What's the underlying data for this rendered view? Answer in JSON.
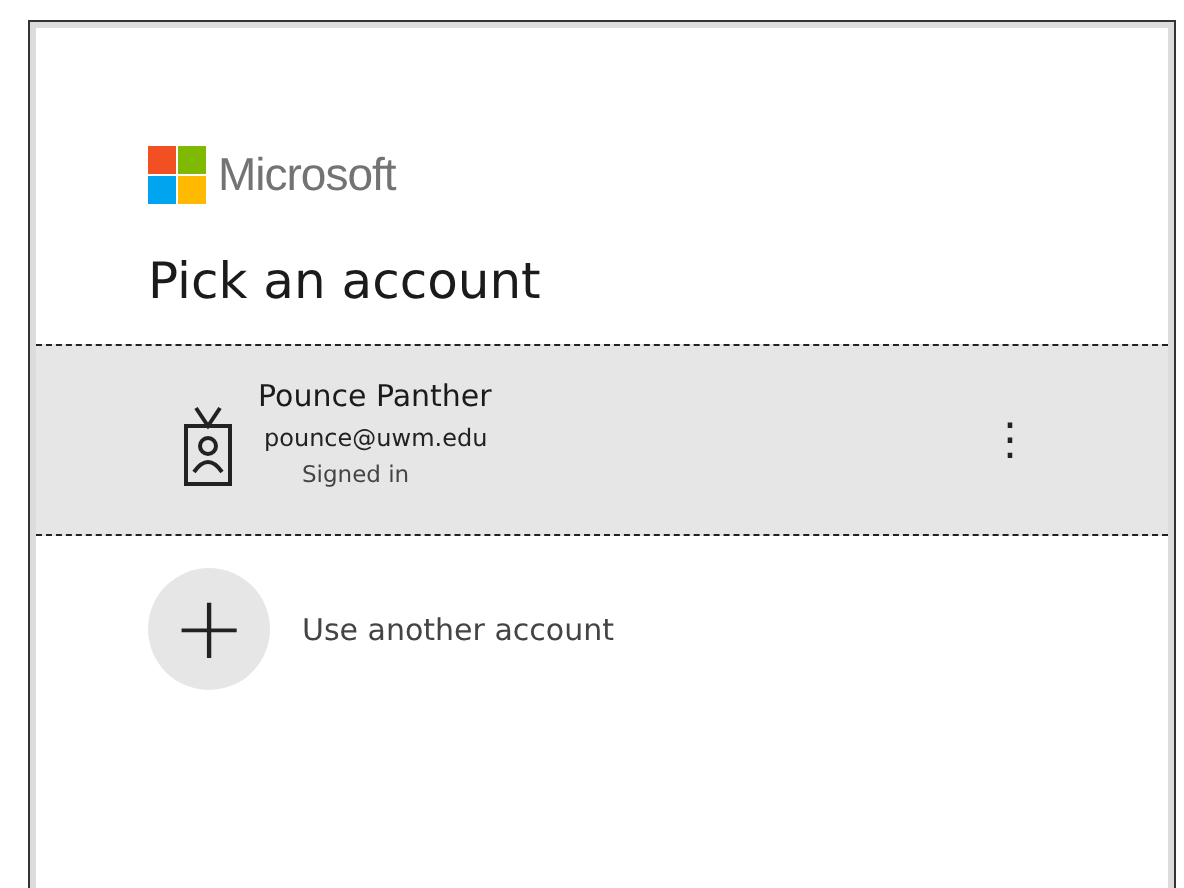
{
  "brand": "Microsoft",
  "title": "Pick an account",
  "accounts": [
    {
      "name": "Pounce Panther",
      "email": "pounce@uwm.edu",
      "status": "Signed in",
      "selected": true
    }
  ],
  "other_account": {
    "icon": "+",
    "label": "Use another account"
  },
  "more_menu": "⋮"
}
